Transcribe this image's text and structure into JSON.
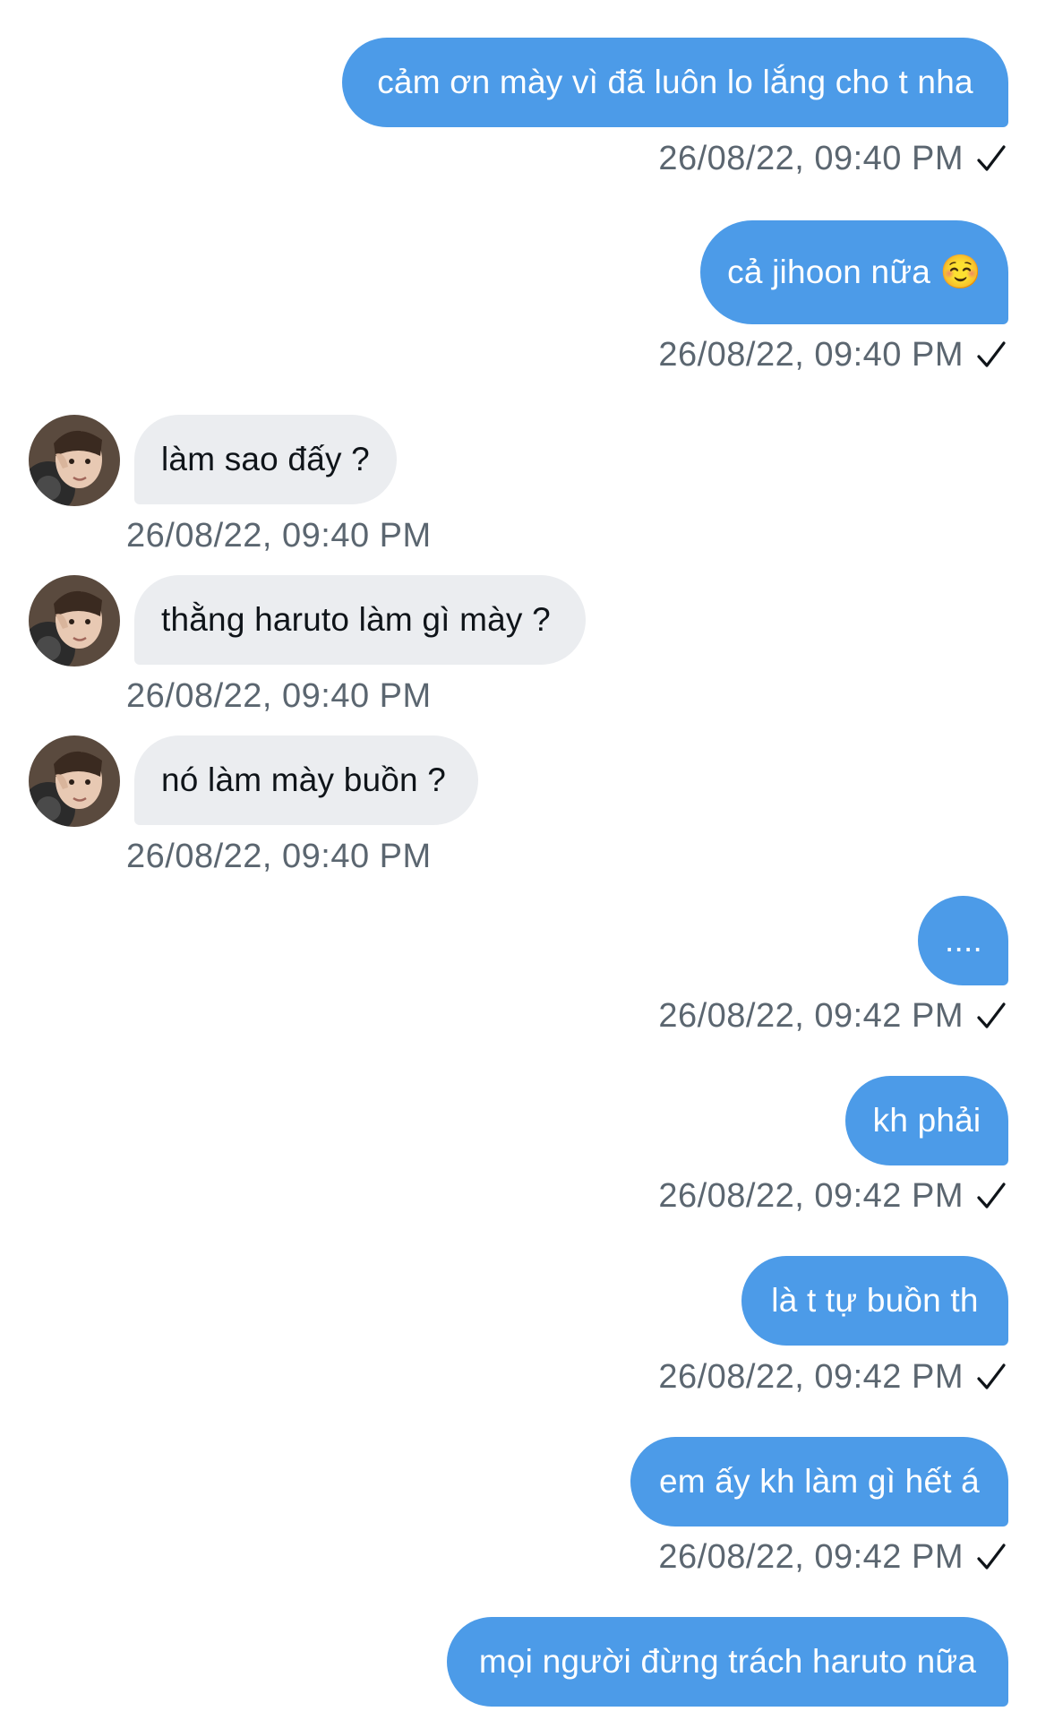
{
  "colors": {
    "accent": "#4c9be8",
    "incoming": "#ebedf0",
    "meta": "#5b6670"
  },
  "messages": [
    {
      "text": "cảm ơn mày vì đã luôn lo lắng cho t nha",
      "time": "26/08/22, 09:40 PM",
      "direction": "outgoing",
      "status_icon": "check-icon"
    },
    {
      "text": "cả jihoon nữa ☺️",
      "time": "26/08/22, 09:40 PM",
      "direction": "outgoing",
      "status_icon": "check-icon"
    },
    {
      "text": "làm sao đấy ?",
      "time": "26/08/22, 09:40 PM",
      "direction": "incoming",
      "avatar_icon": "avatar-photo"
    },
    {
      "text": "thằng haruto làm gì mày ?",
      "time": "26/08/22, 09:40 PM",
      "direction": "incoming",
      "avatar_icon": "avatar-photo"
    },
    {
      "text": "nó làm mày buồn ?",
      "time": "26/08/22, 09:40 PM",
      "direction": "incoming",
      "avatar_icon": "avatar-photo"
    },
    {
      "text": "....",
      "time": "26/08/22, 09:42 PM",
      "direction": "outgoing",
      "status_icon": "check-icon"
    },
    {
      "text": "kh phải",
      "time": "26/08/22, 09:42 PM",
      "direction": "outgoing",
      "status_icon": "check-icon"
    },
    {
      "text": "là t tự buồn th",
      "time": "26/08/22, 09:42 PM",
      "direction": "outgoing",
      "status_icon": "check-icon"
    },
    {
      "text": "em ấy kh làm gì hết á",
      "time": "26/08/22, 09:42 PM",
      "direction": "outgoing",
      "status_icon": "check-icon"
    },
    {
      "text": "mọi người đừng trách haruto nữa",
      "time": "",
      "direction": "outgoing"
    }
  ]
}
